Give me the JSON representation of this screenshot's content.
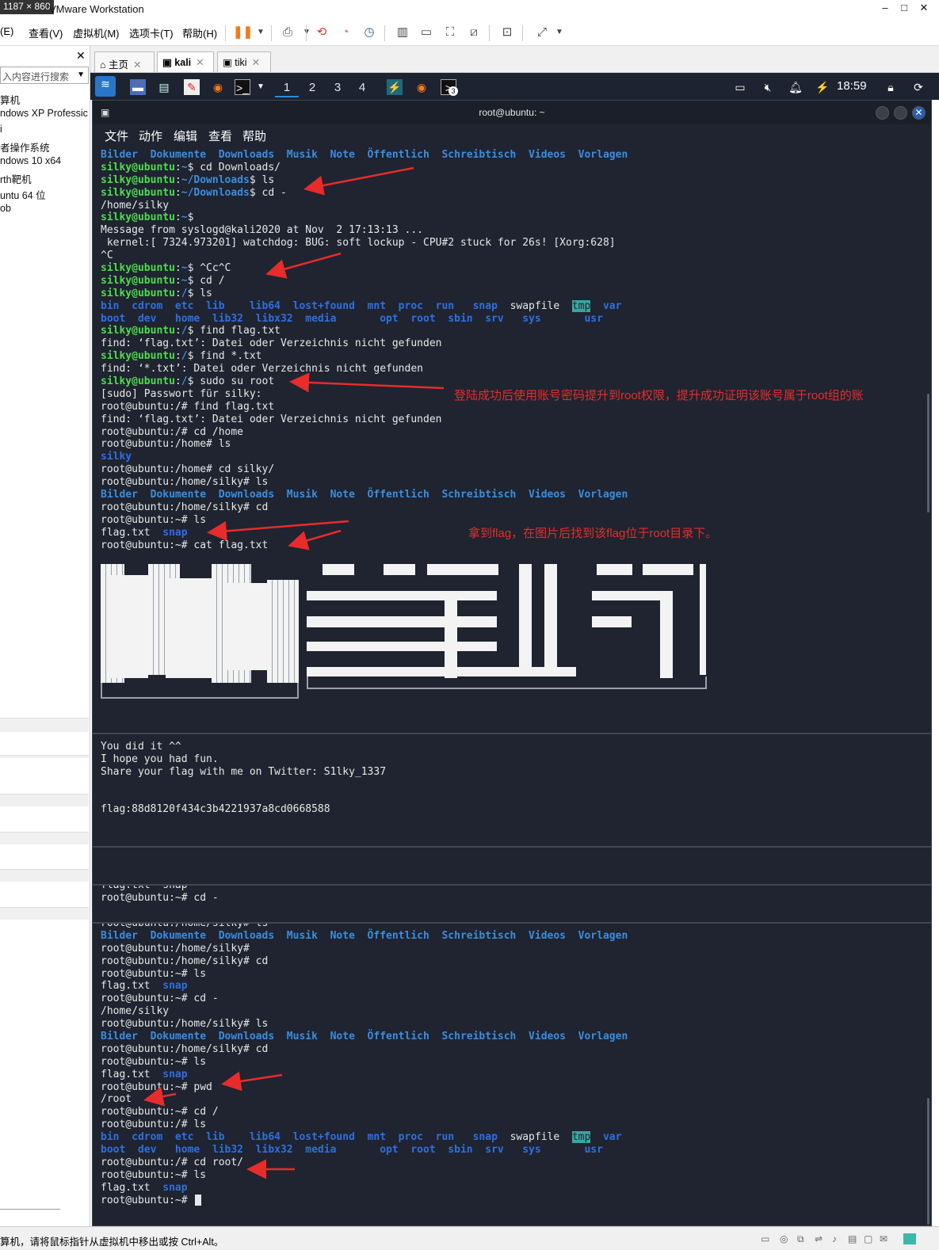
{
  "window": {
    "dimensions": "1187 × 860",
    "title": "VMware Workstation"
  },
  "menus": [
    "(E)",
    "查看(V)",
    "虚拟机(M)",
    "选项卡(T)",
    "帮助(H)"
  ],
  "sidebar": {
    "search_placeholder": "入内容进行搜索",
    "items": [
      "算机",
      "ndows XP Professic",
      "i",
      "者操作系统",
      "ndows 10 x64",
      "rth靶机",
      "untu 64 位",
      "ob"
    ]
  },
  "tabs": [
    {
      "label": "主页"
    },
    {
      "label": "kali"
    },
    {
      "label": "tiki"
    }
  ],
  "panel": {
    "workspaces": [
      "1",
      "2",
      "3",
      "4"
    ],
    "clock": "18:59",
    "badge": "3"
  },
  "terminal": {
    "title": "root@ubuntu: ~",
    "menu": [
      "文件",
      "动作",
      "编辑",
      "查看",
      "帮助"
    ],
    "lines1": [
      [
        [
          "b",
          "Bilder  Dokumente  Downloads  Musik  Note  Öffentlich  Schreibtisch  Videos  Vorlagen"
        ]
      ],
      [
        [
          "g",
          "silky@ubuntu"
        ],
        [
          "w",
          ":"
        ],
        [
          "b",
          "~"
        ],
        [
          "w",
          "$ cd Downloads/"
        ]
      ],
      [
        [
          "g",
          "silky@ubuntu"
        ],
        [
          "w",
          ":"
        ],
        [
          "b",
          "~/Downloads"
        ],
        [
          "w",
          "$ ls"
        ]
      ],
      [
        [
          "g",
          "silky@ubuntu"
        ],
        [
          "w",
          ":"
        ],
        [
          "b",
          "~/Downloads"
        ],
        [
          "w",
          "$ cd -"
        ]
      ],
      [
        [
          "w",
          "/home/silky"
        ]
      ],
      [
        [
          "g",
          "silky@ubuntu"
        ],
        [
          "w",
          ":"
        ],
        [
          "b",
          "~"
        ],
        [
          "w",
          "$"
        ]
      ],
      [
        [
          "w",
          "Message from syslogd@kali2020 at Nov  2 17:13:13 ..."
        ]
      ],
      [
        [
          "w",
          " kernel:[ 7324.973201] watchdog: BUG: soft lockup - CPU#2 stuck for 26s! [Xorg:628]"
        ]
      ],
      [
        [
          "w",
          "^C"
        ]
      ],
      [
        [
          "g",
          "silky@ubuntu"
        ],
        [
          "w",
          ":"
        ],
        [
          "b",
          "~"
        ],
        [
          "w",
          "$ ^Cc^C"
        ]
      ],
      [
        [
          "g",
          "silky@ubuntu"
        ],
        [
          "w",
          ":"
        ],
        [
          "b",
          "~"
        ],
        [
          "w",
          "$ cd /"
        ]
      ],
      [
        [
          "g",
          "silky@ubuntu"
        ],
        [
          "w",
          ":"
        ],
        [
          "b",
          "/"
        ],
        [
          "w",
          "$ ls"
        ]
      ],
      [
        [
          "bl",
          "bin  cdrom  etc  lib    lib64  lost+found  mnt  proc  run   snap  "
        ],
        [
          "w",
          "swapfile  "
        ],
        [
          "hl",
          "tmp"
        ],
        [
          "w",
          "  "
        ],
        [
          "bl",
          "var"
        ]
      ],
      [
        [
          "bl",
          "boot  dev   home  lib32  libx32  media       opt  root  sbin  srv   sys       usr"
        ]
      ],
      [
        [
          "g",
          "silky@ubuntu"
        ],
        [
          "w",
          ":"
        ],
        [
          "b",
          "/"
        ],
        [
          "w",
          "$ find flag.txt"
        ]
      ],
      [
        [
          "w",
          "find: ‘flag.txt’: Datei oder Verzeichnis nicht gefunden"
        ]
      ],
      [
        [
          "g",
          "silky@ubuntu"
        ],
        [
          "w",
          ":"
        ],
        [
          "b",
          "/"
        ],
        [
          "w",
          "$ find *.txt"
        ]
      ],
      [
        [
          "w",
          "find: ‘*.txt’: Datei oder Verzeichnis nicht gefunden"
        ]
      ],
      [
        [
          "g",
          "silky@ubuntu"
        ],
        [
          "w",
          ":"
        ],
        [
          "b",
          "/"
        ],
        [
          "w",
          "$ sudo su root"
        ]
      ],
      [
        [
          "w",
          "[sudo] Passwort für silky:"
        ]
      ],
      [
        [
          "w",
          "root@ubuntu:/# find flag.txt"
        ]
      ],
      [
        [
          "w",
          "find: ‘flag.txt’: Datei oder Verzeichnis nicht gefunden"
        ]
      ],
      [
        [
          "w",
          "root@ubuntu:/# cd /home"
        ]
      ],
      [
        [
          "w",
          "root@ubuntu:/home# ls"
        ]
      ],
      [
        [
          "bl",
          "silky"
        ]
      ],
      [
        [
          "w",
          "root@ubuntu:/home# cd silky/"
        ]
      ],
      [
        [
          "w",
          "root@ubuntu:/home/silky# ls"
        ]
      ],
      [
        [
          "b",
          "Bilder  Dokumente  Downloads  Musik  Note  Öffentlich  Schreibtisch  Videos  Vorlagen"
        ]
      ],
      [
        [
          "w",
          "root@ubuntu:/home/silky# cd"
        ]
      ],
      [
        [
          "w",
          "root@ubuntu:~# ls"
        ]
      ],
      [
        [
          "w",
          "flag.txt  "
        ],
        [
          "bl",
          "snap"
        ]
      ],
      [
        [
          "w",
          "root@ubuntu:~# cat flag.txt"
        ]
      ]
    ],
    "lines2": [
      [
        [
          "w",
          "You did it ^^"
        ]
      ],
      [
        [
          "w",
          "I hope you had fun."
        ]
      ],
      [
        [
          "w",
          "Share your flag with me on Twitter: S1lky_1337"
        ]
      ],
      [
        [
          "w",
          ""
        ]
      ],
      [
        [
          "w",
          ""
        ]
      ],
      [
        [
          "w",
          "flag:88d8120f434c3b4221937a8cd0668588"
        ]
      ]
    ],
    "lines4": [
      [
        [
          "w",
          "flag.txt  snap"
        ]
      ],
      [
        [
          "w",
          "root@ubuntu:~# cd -"
        ]
      ]
    ],
    "lines5": [
      [
        [
          "w",
          "root@ubuntu:/home/silky# ls"
        ]
      ],
      [
        [
          "b",
          "Bilder  Dokumente  Downloads  Musik  Note  Öffentlich  Schreibtisch  Videos  Vorlagen"
        ]
      ],
      [
        [
          "w",
          "root@ubuntu:/home/silky#"
        ]
      ],
      [
        [
          "w",
          "root@ubuntu:/home/silky# cd"
        ]
      ],
      [
        [
          "w",
          "root@ubuntu:~# ls"
        ]
      ],
      [
        [
          "w",
          "flag.txt  "
        ],
        [
          "bl",
          "snap"
        ]
      ],
      [
        [
          "w",
          "root@ubuntu:~# cd -"
        ]
      ],
      [
        [
          "w",
          "/home/silky"
        ]
      ],
      [
        [
          "w",
          "root@ubuntu:/home/silky# ls"
        ]
      ],
      [
        [
          "b",
          "Bilder  Dokumente  Downloads  Musik  Note  Öffentlich  Schreibtisch  Videos  Vorlagen"
        ]
      ],
      [
        [
          "w",
          "root@ubuntu:/home/silky# cd"
        ]
      ],
      [
        [
          "w",
          "root@ubuntu:~# ls"
        ]
      ],
      [
        [
          "w",
          "flag.txt  "
        ],
        [
          "bl",
          "snap"
        ]
      ],
      [
        [
          "w",
          "root@ubuntu:~# pwd"
        ]
      ],
      [
        [
          "w",
          "/root"
        ]
      ],
      [
        [
          "w",
          "root@ubuntu:~# cd /"
        ]
      ],
      [
        [
          "w",
          "root@ubuntu:/# ls"
        ]
      ],
      [
        [
          "bl",
          "bin  cdrom  etc  lib    lib64  lost+found  mnt  proc  run   snap  "
        ],
        [
          "w",
          "swapfile  "
        ],
        [
          "hl",
          "tmp"
        ],
        [
          "w",
          "  "
        ],
        [
          "bl",
          "var"
        ]
      ],
      [
        [
          "bl",
          "boot  dev   home  lib32  libx32  media       opt  root  sbin  srv   sys       usr"
        ]
      ],
      [
        [
          "w",
          "root@ubuntu:/# cd root/"
        ]
      ],
      [
        [
          "w",
          "root@ubuntu:~# ls"
        ]
      ],
      [
        [
          "w",
          "flag.txt  "
        ],
        [
          "bl",
          "snap"
        ]
      ],
      [
        [
          "w",
          "root@ubuntu:~# "
        ]
      ]
    ]
  },
  "annotations": {
    "a1": "登陆成功后使用账号密码提升到root权限，提升成功证明该账号属于root组的账",
    "a2": "拿到flag，在图片后找到该flag位于root目录下。"
  },
  "status": {
    "message": "算机，请将鼠标指针从虚拟机中移出或按 Ctrl+Alt。"
  },
  "colors": {
    "prompt_green": "#4edc4e",
    "dir_blue": "#3b8de0",
    "annotation_red": "#e82b2b",
    "terminal_bg": "#1f2430"
  }
}
